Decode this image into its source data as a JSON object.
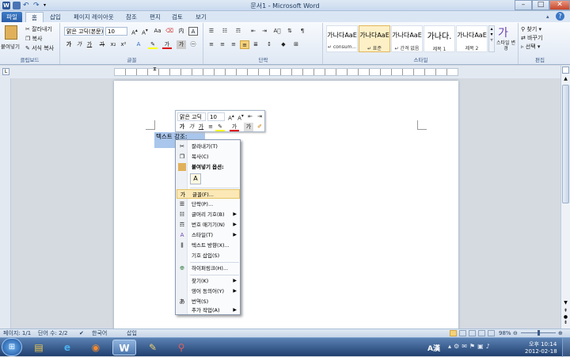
{
  "window": {
    "title": "문서1 - Microsoft Word"
  },
  "tabs": [
    "파일",
    "홈",
    "삽입",
    "페이지 레이아웃",
    "참조",
    "편지",
    "검토",
    "보기"
  ],
  "clipboard": {
    "paste": "붙여넣기",
    "cut": "잘라내기",
    "copy": "복사",
    "format_painter": "서식 복사",
    "label": "클립보드"
  },
  "font": {
    "name": "맑은 고딕(본문)",
    "size": "10",
    "label": "글꼴"
  },
  "paragraph": {
    "label": "단락"
  },
  "styles": {
    "items": [
      {
        "sample": "가나다AaE",
        "name": "↵ consum..."
      },
      {
        "sample": "가나다AaE",
        "name": "↵ 표준"
      },
      {
        "sample": "가나다AaE",
        "name": "↵ 간격 없음"
      },
      {
        "sample": "가나다.",
        "name": "제목 1"
      },
      {
        "sample": "가나다AaE",
        "name": "제목 2"
      }
    ],
    "change": "스타일 변경",
    "label": "스타일"
  },
  "editing": {
    "find": "찾기",
    "replace": "바꾸기",
    "select": "선택",
    "label": "편집"
  },
  "document": {
    "selected_text": "텍스트 강조:"
  },
  "minitoolbar": {
    "font": "맑은 고딕",
    "size": "10"
  },
  "context_menu": {
    "items": [
      {
        "icon": "scissors-icon",
        "label": "잘라내기(T)",
        "arrow": ""
      },
      {
        "icon": "copy-icon",
        "label": "복사(C)",
        "arrow": ""
      },
      {
        "icon": "paste-icon",
        "label": "붙여넣기 옵션:",
        "arrow": ""
      },
      {
        "icon": "font-icon",
        "label": "글꼴(F)...",
        "arrow": ""
      },
      {
        "icon": "paragraph-icon",
        "label": "단락(P)...",
        "arrow": ""
      },
      {
        "icon": "bullets-icon",
        "label": "글머리 기호(B)",
        "arrow": "▶"
      },
      {
        "icon": "numbering-icon",
        "label": "번호 매기기(N)",
        "arrow": "▶"
      },
      {
        "icon": "styles-icon",
        "label": "스타일(T)",
        "arrow": "▶"
      },
      {
        "icon": "text-direction-icon",
        "label": "텍스트 방향(X)...",
        "arrow": ""
      },
      {
        "icon": "",
        "label": "기호 삽입(S)",
        "arrow": ""
      },
      {
        "icon": "hyperlink-icon",
        "label": "하이퍼링크(H)...",
        "arrow": ""
      },
      {
        "icon": "",
        "label": "찾기(K)",
        "arrow": "▶"
      },
      {
        "icon": "",
        "label": "영어 동의어(Y)",
        "arrow": "▶"
      },
      {
        "icon": "translate-icon",
        "label": "번역(S)",
        "arrow": ""
      },
      {
        "icon": "",
        "label": "추가 작업(A)",
        "arrow": "▶"
      }
    ]
  },
  "status": {
    "page": "페이지: 1/1",
    "words": "단어 수: 2/2",
    "language": "한국어",
    "mode": "삽입",
    "zoom": "98%"
  },
  "taskbar": {
    "ime": "A漢",
    "time": "오후 10:14",
    "date": "2012-02-18"
  }
}
